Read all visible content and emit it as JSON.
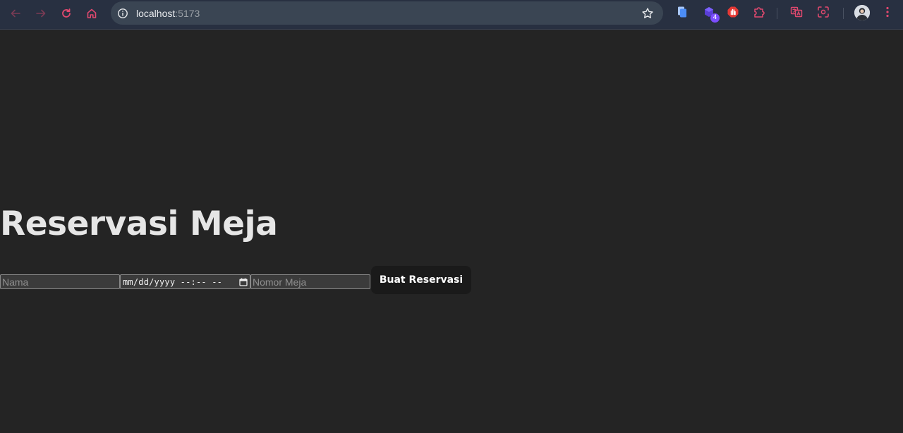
{
  "browser": {
    "url_host": "localhost",
    "url_port": ":5173",
    "extension_badge": "4",
    "icons": {
      "back": "arrow-left-icon",
      "forward": "arrow-right-icon",
      "reload": "reload-icon",
      "home": "home-icon",
      "site_info": "info-icon",
      "bookmark": "star-icon",
      "menu": "kebab-menu-icon"
    },
    "colors": {
      "toolbar_bg": "#283041",
      "omnibox_bg": "#3a4553",
      "nav_icon": "#e2496f"
    }
  },
  "page": {
    "title": "Reservasi Meja",
    "background": "#242424"
  },
  "form": {
    "name_placeholder": "Nama",
    "datetime_display": "mm/dd/yyyy --:-- --",
    "table_placeholder": "Nomor Meja",
    "submit_label": "Buat Reservasi"
  }
}
